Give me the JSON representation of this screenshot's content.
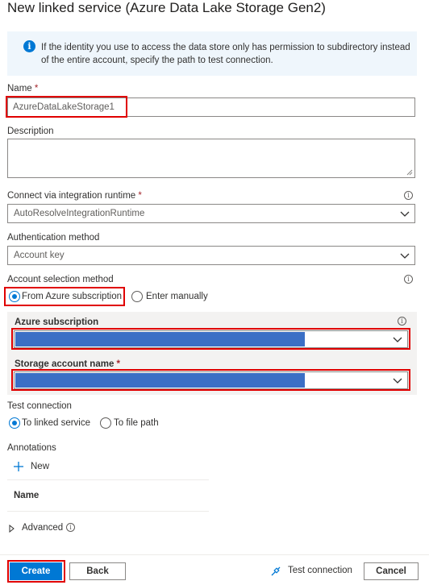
{
  "dialog": {
    "title": "New linked service (Azure Data Lake Storage Gen2)"
  },
  "info": {
    "icon": "info-icon",
    "text": "If the identity you use to access the data store only has permission to subdirectory instead of the entire account, specify the path to test connection."
  },
  "name_field": {
    "label": "Name",
    "required": "*",
    "value": "AzureDataLakeStorage1"
  },
  "description_field": {
    "label": "Description",
    "value": ""
  },
  "runtime_field": {
    "label": "Connect via integration runtime",
    "required": "*",
    "value": "AutoResolveIntegrationRuntime"
  },
  "auth_field": {
    "label": "Authentication method",
    "value": "Account key"
  },
  "account_selection": {
    "label": "Account selection method",
    "options": [
      "From Azure subscription",
      "Enter manually"
    ],
    "selected": "From Azure subscription"
  },
  "subscription_field": {
    "label": "Azure subscription",
    "value": ""
  },
  "storage_field": {
    "label": "Storage account name",
    "required": "*",
    "value": ""
  },
  "test_connection": {
    "label": "Test connection",
    "options": [
      "To linked service",
      "To file path"
    ],
    "selected": "To linked service"
  },
  "annotations": {
    "label": "Annotations",
    "new_label": "New",
    "column_header": "Name"
  },
  "advanced": {
    "label": "Advanced"
  },
  "footer": {
    "create": "Create",
    "back": "Back",
    "test": "Test connection",
    "cancel": "Cancel"
  },
  "colors": {
    "accent": "#0078d4",
    "highlight": "#e00000",
    "redacted": "#3b6fc5"
  }
}
